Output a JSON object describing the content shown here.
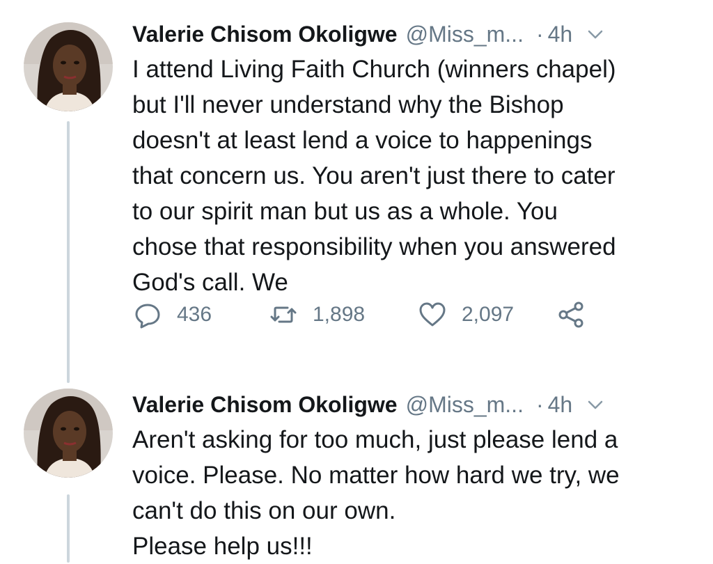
{
  "tweets": [
    {
      "avatar_icon": "profile-photo",
      "display_name": "Valerie Chisom Okoligwe",
      "handle": "@Miss_m...",
      "separator": "·",
      "time": "4h",
      "text": "I attend Living Faith Church (winners chapel)\nbut I'll never understand why the Bishop\ndoesn't at least lend a voice to happenings\nthat concern us. You aren't just there to cater\nto our spirit man but us as a whole. You\nchose that responsibility when you answered\nGod's call. We",
      "actions": {
        "reply_count": "436",
        "retweet_count": "1,898",
        "like_count": "2,097"
      }
    },
    {
      "avatar_icon": "profile-photo",
      "display_name": "Valerie Chisom Okoligwe",
      "handle": "@Miss_m...",
      "separator": "·",
      "time": "4h",
      "text": "Aren't asking for too much, just please lend a\nvoice. Please. No matter how hard we try, we\ncan't do this on our own.\nPlease help us!!!"
    }
  ],
  "colors": {
    "text_primary": "#14171a",
    "text_secondary": "#657786",
    "thread_line": "#ccd6dd"
  }
}
